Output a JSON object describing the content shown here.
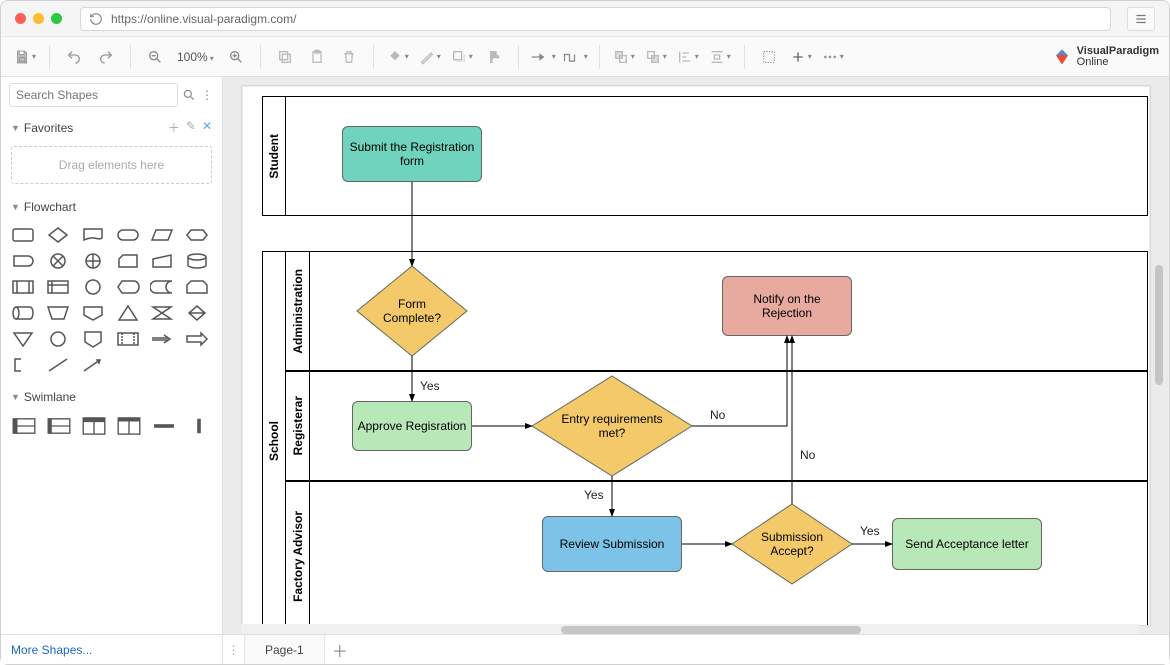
{
  "browser": {
    "url": "https://online.visual-paradigm.com/"
  },
  "brand": {
    "line1": "VisualParadigm",
    "line2": "Online"
  },
  "toolbar": {
    "zoom": "100%"
  },
  "sidebar": {
    "search_placeholder": "Search Shapes",
    "favorites_title": "Favorites",
    "favorites_drop": "Drag elements here",
    "flowchart_title": "Flowchart",
    "swimlane_title": "Swimlane",
    "more_shapes": "More Shapes..."
  },
  "tabs": {
    "page1": "Page-1"
  },
  "diagram": {
    "pool1": "Student",
    "pool2": "School",
    "lane_admin": "Administration",
    "lane_registerar": "Registerar",
    "lane_advisor": "Factory Advisor",
    "submit_registration": "Submit the Registration form",
    "form_complete": "Form Complete?",
    "approve_registration": "Approve Regisration",
    "entry_requirements": "Entry requirements met?",
    "notify_rejection": "Notify on the Rejection",
    "review_submission": "Review Submission",
    "submission_accept": "Submission Accept?",
    "send_acceptance": "Send Acceptance letter",
    "label_yes1": "Yes",
    "label_no1": "No",
    "label_yes2": "Yes",
    "label_no2": "No",
    "label_yes3": "Yes"
  }
}
